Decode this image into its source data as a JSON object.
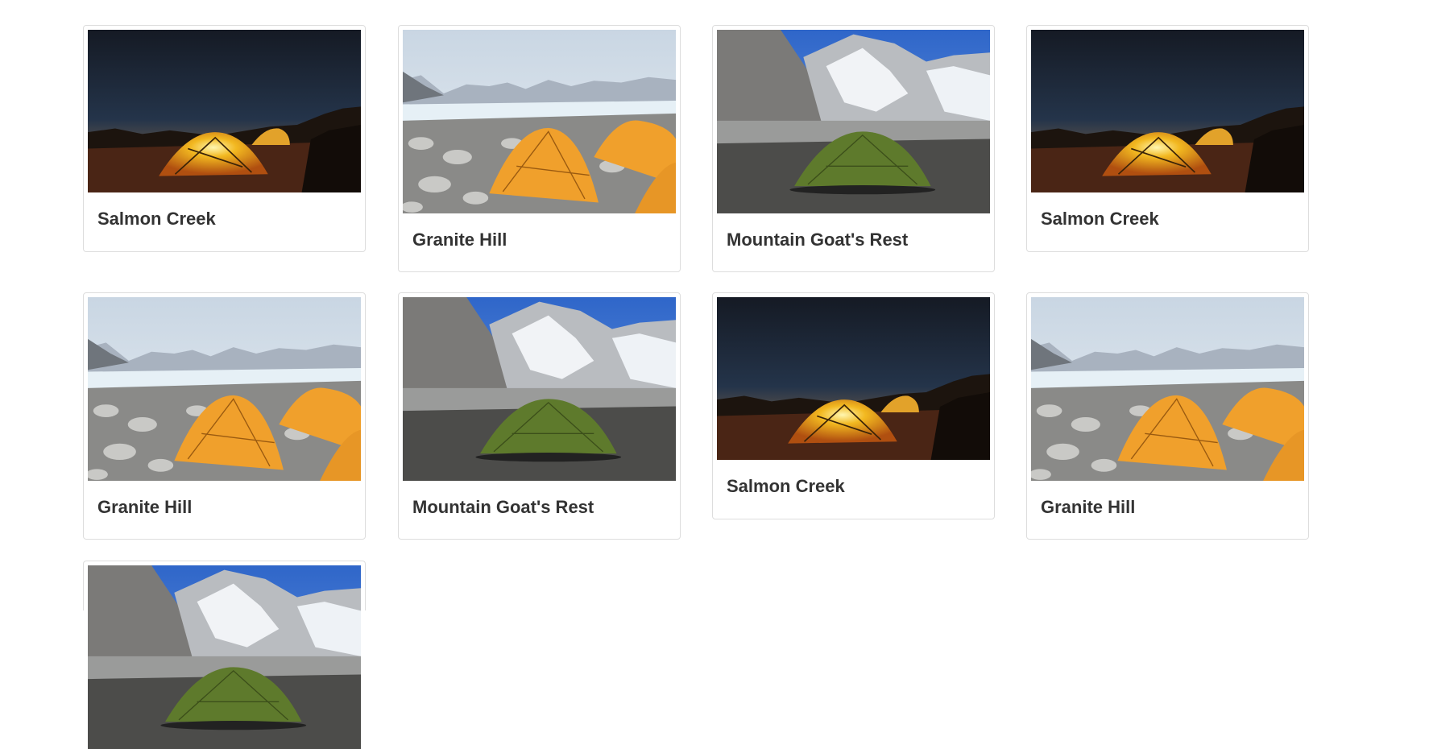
{
  "grid": {
    "cards": [
      {
        "name": "Salmon Creek",
        "scene": "night-tent-icon"
      },
      {
        "name": "Granite Hill",
        "scene": "orange-tents-icon"
      },
      {
        "name": "Mountain Goat's Rest",
        "scene": "green-tent-icon"
      },
      {
        "name": "Salmon Creek",
        "scene": "night-tent-icon"
      },
      {
        "name": "Granite Hill",
        "scene": "orange-tents-icon"
      },
      {
        "name": "Mountain Goat's Rest",
        "scene": "green-tent-icon"
      },
      {
        "name": "Salmon Creek",
        "scene": "night-tent-icon"
      },
      {
        "name": "Granite Hill",
        "scene": "orange-tents-icon"
      },
      {
        "name": "",
        "scene": "green-tent-icon"
      }
    ]
  },
  "colors": {
    "card_border": "#dddddd",
    "caption_text": "#333333"
  }
}
